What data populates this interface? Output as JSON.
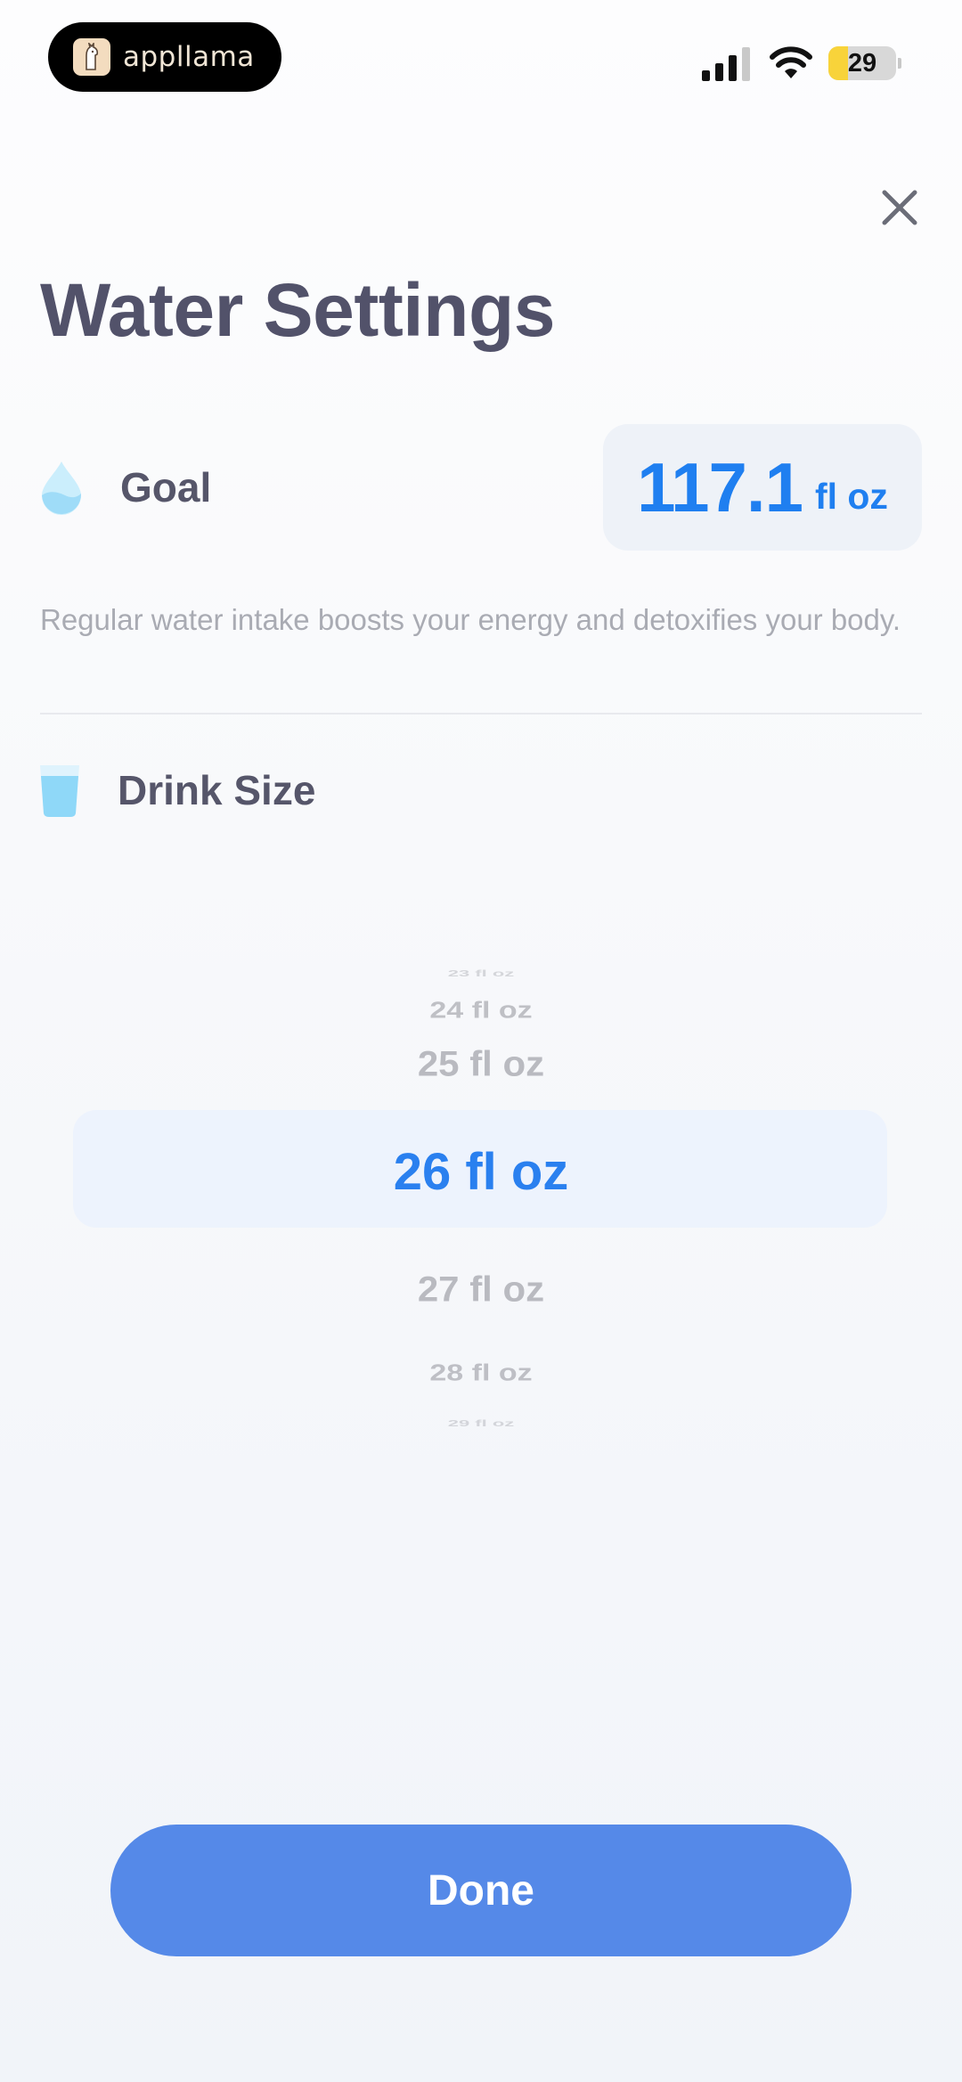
{
  "status_bar": {
    "brand_name": "appllama",
    "battery_level": "29",
    "battery_fraction": 0.29,
    "icons": [
      "llama-logo-icon",
      "cellular-signal-icon",
      "wifi-icon",
      "battery-icon"
    ]
  },
  "header": {
    "title": "Water Settings",
    "close_icon": "close-icon"
  },
  "goal": {
    "icon": "water-drop-icon",
    "label": "Goal",
    "value": "117.1",
    "unit": "fl oz",
    "description": "Regular water intake boosts your energy and detoxifies your body."
  },
  "drink_size": {
    "icon": "water-glass-icon",
    "label": "Drink Size",
    "picker_items": [
      "23 fl oz",
      "24 fl oz",
      "25 fl oz",
      "26 fl oz",
      "27 fl oz",
      "28 fl oz",
      "29 fl oz"
    ],
    "selected": "26 fl oz"
  },
  "footer": {
    "done_label": "Done"
  },
  "colors": {
    "accent": "#2a80ef",
    "button": "#5589e8",
    "title": "#52526a",
    "muted": "#a9abb3"
  }
}
